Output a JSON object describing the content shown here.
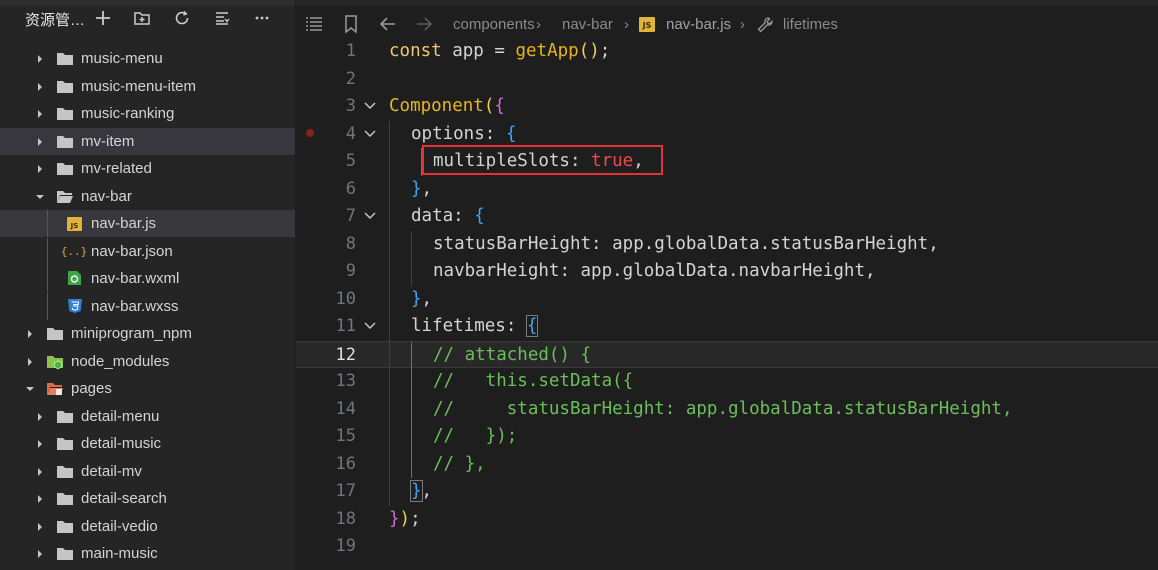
{
  "sidebar": {
    "title": "资源管…",
    "actions": [
      "new-file-icon",
      "new-folder-icon",
      "refresh-icon",
      "collapse-icon",
      "more-icon"
    ],
    "items": [
      {
        "label": "music-menu",
        "type": "folder",
        "expanded": false,
        "depth": 1
      },
      {
        "label": "music-menu-item",
        "type": "folder",
        "expanded": false,
        "depth": 1
      },
      {
        "label": "music-ranking",
        "type": "folder",
        "expanded": false,
        "depth": 1
      },
      {
        "label": "mv-item",
        "type": "folder",
        "expanded": false,
        "depth": 1,
        "hover": true
      },
      {
        "label": "mv-related",
        "type": "folder",
        "expanded": false,
        "depth": 1
      },
      {
        "label": "nav-bar",
        "type": "folder",
        "expanded": true,
        "depth": 1
      },
      {
        "label": "nav-bar.js",
        "type": "js",
        "depth": 2,
        "selected": true
      },
      {
        "label": "nav-bar.json",
        "type": "json",
        "depth": 2
      },
      {
        "label": "nav-bar.wxml",
        "type": "wxml",
        "depth": 2
      },
      {
        "label": "nav-bar.wxss",
        "type": "wxss",
        "depth": 2
      },
      {
        "label": "miniprogram_npm",
        "type": "folder",
        "expanded": false,
        "depth": 0
      },
      {
        "label": "node_modules",
        "type": "node-folder",
        "expanded": false,
        "depth": 0
      },
      {
        "label": "pages",
        "type": "pages-folder",
        "expanded": true,
        "depth": 0
      },
      {
        "label": "detail-menu",
        "type": "folder",
        "expanded": false,
        "depth": 1
      },
      {
        "label": "detail-music",
        "type": "folder",
        "expanded": false,
        "depth": 1
      },
      {
        "label": "detail-mv",
        "type": "folder",
        "expanded": false,
        "depth": 1
      },
      {
        "label": "detail-search",
        "type": "folder",
        "expanded": false,
        "depth": 1
      },
      {
        "label": "detail-vedio",
        "type": "folder",
        "expanded": false,
        "depth": 1
      },
      {
        "label": "main-music",
        "type": "folder",
        "expanded": false,
        "depth": 1
      }
    ]
  },
  "breadcrumb": {
    "segments": [
      "components",
      "nav-bar",
      "nav-bar.js",
      "lifetimes"
    ],
    "file_badge": "JS"
  },
  "editor": {
    "current_line": 12,
    "lines": [
      {
        "n": "1",
        "text": "const app = getApp();"
      },
      {
        "n": "2",
        "text": ""
      },
      {
        "n": "3",
        "text": "Component({"
      },
      {
        "n": "4",
        "text": "options: {"
      },
      {
        "n": "5",
        "text": "multipleSlots: true,"
      },
      {
        "n": "6",
        "text": "},"
      },
      {
        "n": "7",
        "text": "data: {"
      },
      {
        "n": "8",
        "text": "statusBarHeight: app.globalData.statusBarHeight,"
      },
      {
        "n": "9",
        "text": "navbarHeight: app.globalData.navbarHeight,"
      },
      {
        "n": "10",
        "text": "},"
      },
      {
        "n": "11",
        "text": "lifetimes: {"
      },
      {
        "n": "12",
        "text": "// attached() {"
      },
      {
        "n": "13",
        "text": "//   this.setData({"
      },
      {
        "n": "14",
        "text": "//     statusBarHeight: app.globalData.statusBarHeight,"
      },
      {
        "n": "15",
        "text": "//   });"
      },
      {
        "n": "16",
        "text": "// },"
      },
      {
        "n": "17",
        "text": "},"
      },
      {
        "n": "18",
        "text": "});"
      },
      {
        "n": "19",
        "text": ""
      }
    ]
  },
  "colors": {
    "highlight_box": "#e03232",
    "keyword": "#f0c674",
    "comment": "#6bbf59",
    "boolean": "#f44747"
  }
}
